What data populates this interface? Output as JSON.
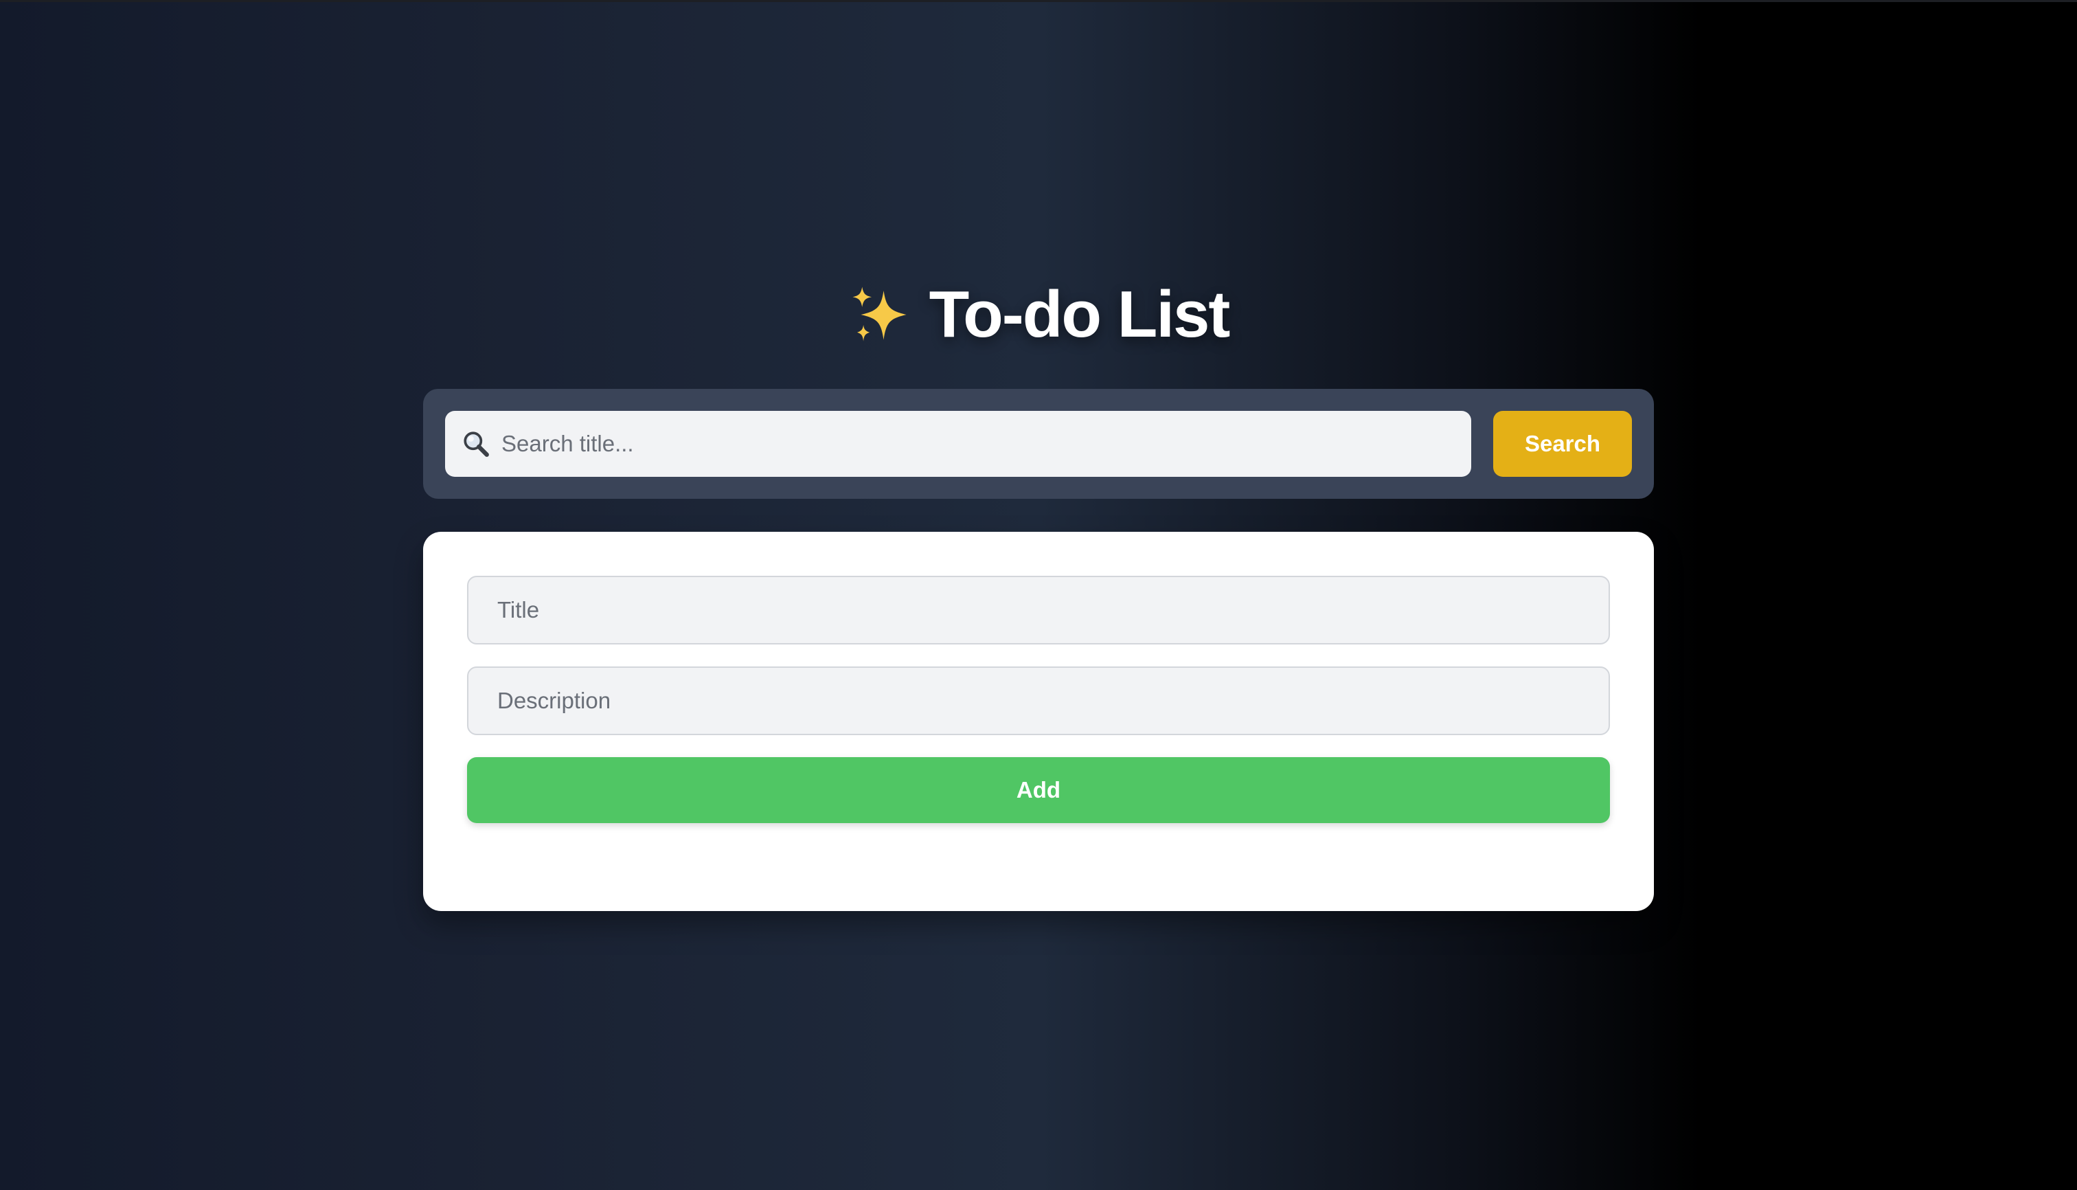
{
  "header": {
    "title": "To-do List",
    "icon": "sparkles-icon"
  },
  "search": {
    "placeholder": "Search title...",
    "value": "",
    "icon": "magnifier-icon",
    "button_label": "Search"
  },
  "form": {
    "title_placeholder": "Title",
    "title_value": "",
    "description_placeholder": "Description",
    "description_value": "",
    "add_label": "Add"
  },
  "colors": {
    "search_button": "#e4b016",
    "add_button": "#50c664",
    "search_bar": "#3a4458"
  }
}
